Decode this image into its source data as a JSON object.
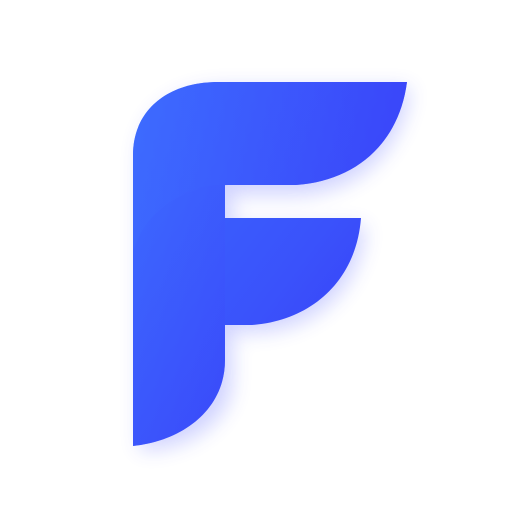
{
  "app_icon": {
    "icon": "letter-f-logo-icon",
    "letter": "F",
    "colors": {
      "background": "#ffffff",
      "primary_light": "#3b6cff",
      "primary_mid": "#3a52fb",
      "primary_dark": "#3633f5",
      "inner_highlight": "#4f74ff",
      "shadow": "#2f3bff"
    }
  }
}
